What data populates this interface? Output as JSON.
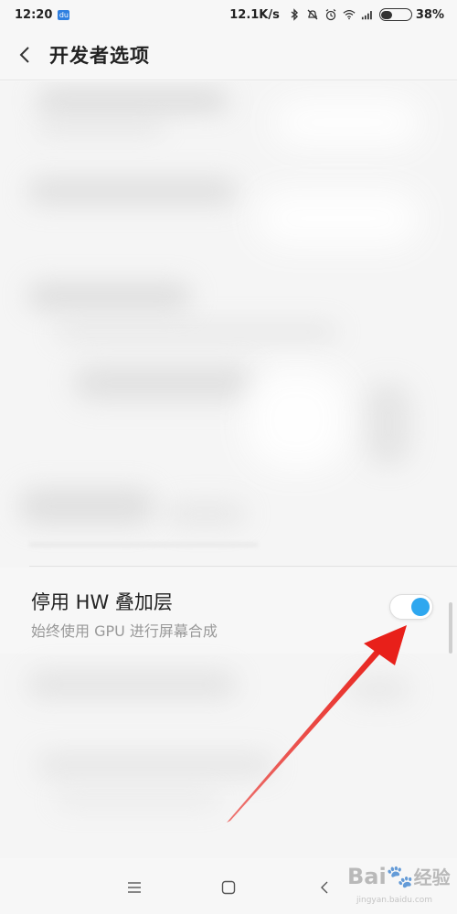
{
  "status_bar": {
    "time": "12:20",
    "app_badge": "du",
    "speed": "12.1K/s",
    "battery_percent": "38%",
    "battery_level": 0.38,
    "icons": [
      "bluetooth-icon",
      "mute-bell-icon",
      "alarm-icon",
      "wifi-icon",
      "signal-icon",
      "battery-icon"
    ]
  },
  "header": {
    "title": "开发者选项"
  },
  "setting": {
    "title": "停用 HW 叠加层",
    "summary": "始终使用 GPU 进行屏幕合成",
    "enabled": true,
    "accent_color": "#2ea7ef"
  },
  "annotation": {
    "arrow_color": "#e8201a"
  },
  "nav_bar": {
    "icons": [
      "menu-icon",
      "home-icon",
      "back-icon"
    ]
  },
  "watermark": {
    "text": "Bai",
    "text2": "经验",
    "sub": "jingyan.baidu.com"
  }
}
